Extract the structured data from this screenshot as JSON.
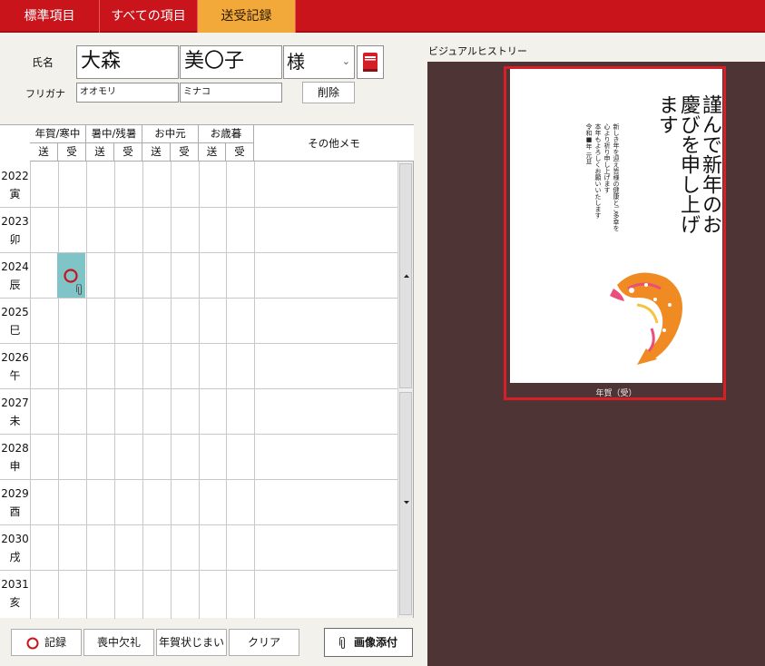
{
  "tabs": [
    {
      "label": "標準項目"
    },
    {
      "label": "すべての項目"
    },
    {
      "label": "送受記録"
    }
  ],
  "form": {
    "name_label": "氏名",
    "furigana_label": "フリガナ",
    "last_name": "大森",
    "first_name": "美〇子",
    "honorific": "様",
    "last_kana": "オオモリ",
    "first_kana": "ミナコ",
    "delete_label": "削除"
  },
  "table": {
    "groups": [
      "年賀/寒中",
      "暑中/残暑",
      "お中元",
      "お歳暮"
    ],
    "sub": [
      "送",
      "受"
    ],
    "memo_header": "その他メモ",
    "rows": [
      {
        "year": "2022",
        "eto": "寅"
      },
      {
        "year": "2023",
        "eto": "卯"
      },
      {
        "year": "2024",
        "eto": "辰"
      },
      {
        "year": "2025",
        "eto": "巳"
      },
      {
        "year": "2026",
        "eto": "午"
      },
      {
        "year": "2027",
        "eto": "未"
      },
      {
        "year": "2028",
        "eto": "申"
      },
      {
        "year": "2029",
        "eto": "酉"
      },
      {
        "year": "2030",
        "eto": "戌"
      },
      {
        "year": "2031",
        "eto": "亥"
      }
    ],
    "marked": {
      "year": "2024",
      "column": "年賀/寒中 受",
      "symbol": "circle",
      "has_attachment": true
    }
  },
  "buttons": {
    "record": "記録",
    "mourning": "喪中欠礼",
    "end_nenga": "年賀状じまい",
    "clear": "クリア",
    "attach": "画像添付"
  },
  "history": {
    "title": "ビジュアルヒストリー",
    "card_caption": "年賀（受）",
    "card_calligraphy": "謹んで新年のお慶びを申し上げます",
    "card_small_text": [
      "新しき年を迎え皆様の健康とご多幸を",
      "心より祈り申し上げます",
      "本年もよろしくお願いいたします",
      "令和■年 元旦"
    ]
  },
  "colors": {
    "tab_red": "#c8141a",
    "tab_active": "#f2a93a",
    "highlight": "#7fc4c6",
    "mark_red": "#c8141a",
    "history_bg": "#4e3434",
    "selection_border": "#d81f26"
  },
  "icons": [
    "book-icon",
    "circle-mark-icon",
    "paperclip-icon",
    "scroll-up-icon",
    "scroll-down-icon",
    "chevron-down-icon"
  ]
}
